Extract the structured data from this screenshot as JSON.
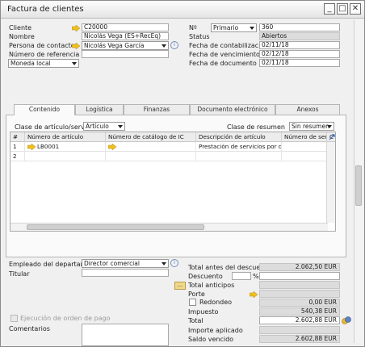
{
  "window": {
    "title": "Factura de clientes"
  },
  "header": {
    "cliente_label": "Cliente",
    "cliente_value": "C20000",
    "nombre_label": "Nombre",
    "nombre_value": "Nicolás Vega (ES+RecEq)",
    "contacto_label": "Persona de contacto",
    "contacto_value": "Nicolás Vega García",
    "referencia_label": "Número de referencia d",
    "referencia_value": "",
    "moneda_value": "Moneda local",
    "no_label": "Nº",
    "serie_value": "Primario",
    "numero_value": "360",
    "status_label": "Status",
    "status_value": "Abiertos",
    "fcont_label": "Fecha de contabilización",
    "fcont_value": "02/11/18",
    "fvenc_label": "Fecha de vencimiento",
    "fvenc_value": "02/12/18",
    "fdoc_label": "Fecha de documento",
    "fdoc_value": "02/11/18"
  },
  "tabs": [
    "Contenido",
    "Logística",
    "Finanzas",
    "Documento electrónico",
    "Anexos"
  ],
  "content": {
    "clase_label": "Clase de artículo/servicio",
    "clase_value": "Artículo",
    "resumen_label": "Clase de resumen",
    "resumen_value": "Sin resumen",
    "columns": [
      "#",
      "Número de artículo",
      "Número de catálogo de IC",
      "Descripción de artículo",
      "Número de serie",
      "C"
    ],
    "rows": [
      {
        "n": "1",
        "articulo": "LB0001",
        "catalogo": "",
        "descripcion": "Prestación de servicios por día"
      },
      {
        "n": "2",
        "articulo": "",
        "catalogo": "",
        "descripcion": ""
      }
    ]
  },
  "footer": {
    "empleado_label": "Empleado del departam",
    "empleado_value": "Director comercial",
    "titular_label": "Titular",
    "ejecucion_label": "Ejecución de orden de pago",
    "comentarios_label": "Comentarios",
    "total_antes_label": "Total antes del descuento",
    "total_antes_value": "2.062,50 EUR",
    "descuento_label": "Descuento",
    "descuento_pct": "%",
    "anticipos_label": "Total anticipos",
    "dots_label": "...",
    "porte_label": "Porte",
    "redondeo_label": "Redondeo",
    "redondeo_value": "0,00 EUR",
    "impuesto_label": "Impuesto",
    "impuesto_value": "540,38 EUR",
    "total_label": "Total",
    "total_value": "2.602,88 EUR",
    "importe_aplicado_label": "Importe aplicado",
    "saldo_label": "Saldo vencido",
    "saldo_value": "2.602,88 EUR"
  },
  "colors": {
    "link_arrow": "#f0c020",
    "highlight_field": "#fff6a8"
  }
}
